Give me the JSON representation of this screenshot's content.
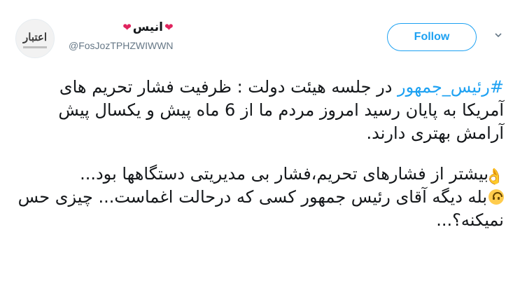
{
  "account": {
    "display_name": "انیس",
    "heart": "❤",
    "username": "@FosJozTPHZWIWWN",
    "avatar_text": "اعتبار"
  },
  "follow_label": "Follow",
  "tweet": {
    "hashtag": "#رئیس_جمهور",
    "line1_rest": " در جلسه هیئت دولت : ظرفیت فشار تحریم های آمریکا به پایان رسید امروز مردم ما از 6 ماه پیش و یکسال پیش آرامش بهتری دارند.",
    "para2": "بیشتر از فشارهای تحریم،فشار بی مدیریتی دستگاهها بود...",
    "para3": "بله دیگه آقای رئیس جمهور کسی که درحالت اغماست... چیزی حس نمیکنه؟...",
    "emoji_ok": "👌",
    "emoji_face": "🙃"
  },
  "colors": {
    "accent": "#1da1f2",
    "heart": "#e0245e",
    "secondary_text": "#657786"
  }
}
